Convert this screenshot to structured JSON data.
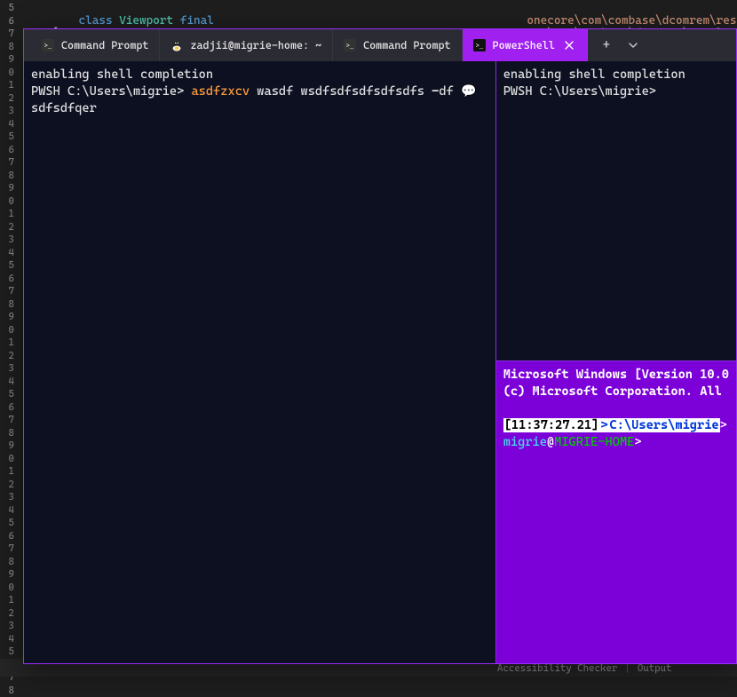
{
  "background_editor": {
    "line_start": 5,
    "line_end": 58,
    "code_tokens": {
      "kw_class": "class",
      "ty_viewport": "Viewport",
      "kw_final": "final",
      "brace": "{"
    },
    "log_line": "onecore\\com\\combase\\dcomrem\\resolve"
  },
  "statusbar": {
    "accessibility": "Accessibility Checker",
    "output": "Output"
  },
  "tabs": [
    {
      "id": "cmd1",
      "label": "Command Prompt",
      "icon": "cmd"
    },
    {
      "id": "wsl",
      "label": "zadjii@migrie-home: ~",
      "icon": "tux"
    },
    {
      "id": "cmd2",
      "label": "Command Prompt",
      "icon": "cmd"
    },
    {
      "id": "ps",
      "label": "PowerShell",
      "icon": "cmd",
      "active": true,
      "closeable": true
    }
  ],
  "tab_controls": {
    "new_tab": "+",
    "dropdown": "⌄"
  },
  "pane_left": {
    "line1": "enabling shell completion",
    "prompt": "PWSH C:\\Users\\migrie>",
    "cmdword": "asdfzxcv",
    "cmdrest1": "wasdf wsdfsdfsdfsdfsdfs",
    "dash": "-",
    "cmdrest2": "df",
    "emoji": "💬",
    "cmdrest3": "sdfsdfqer"
  },
  "pane_right_top": {
    "line1": "enabling shell completion",
    "prompt": "PWSH C:\\Users\\migrie>"
  },
  "pane_right_bottom": {
    "line1": "Microsoft Windows [Version 10.0",
    "line2": "(c) Microsoft Corporation. All",
    "timestamp": "[11:37:27.21]",
    "gt1": ">",
    "path": "C:\\Users\\migrie",
    "gt2": ">",
    "user": "migrie",
    "at": "@",
    "host": "MIGRIE-HOME",
    "gt3": ">"
  }
}
